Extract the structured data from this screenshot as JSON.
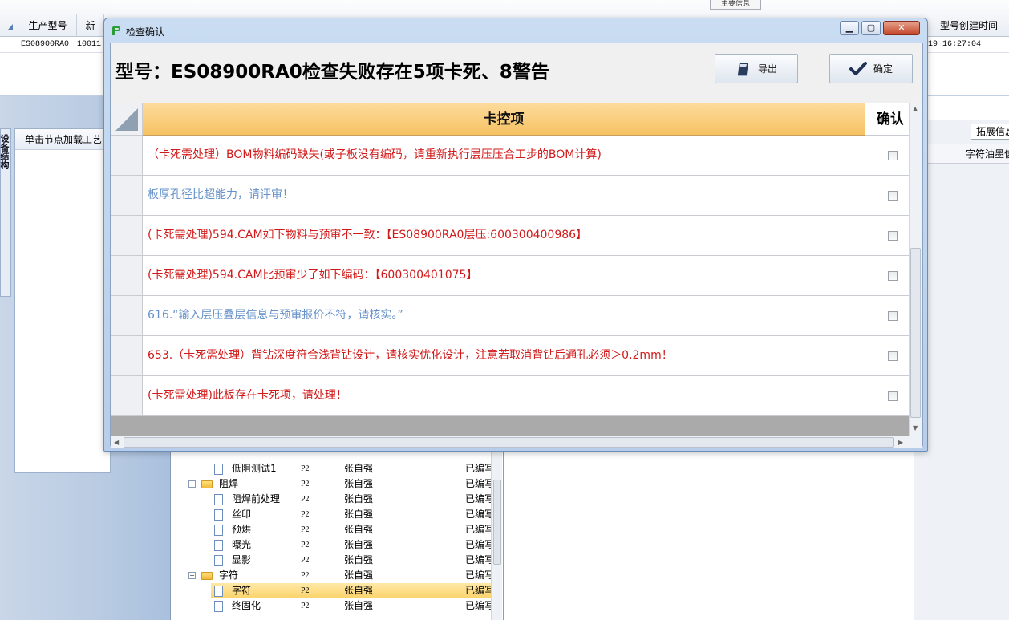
{
  "background": {
    "columns": [
      "生产型号",
      "新",
      "型号创建时间"
    ],
    "info_tab": "主要信息",
    "row": {
      "model": "ES08900RA0",
      "code": "10011",
      "time": "19 16:27:04"
    },
    "left_vtab": "设备结构",
    "left_panel_title": "单击节点加载工艺",
    "right_tab": "拓展信息",
    "right_column": "字符油墨信",
    "tree": [
      {
        "name": "低阻测试1",
        "type": "doc",
        "col1": "P2",
        "col2": "张自强",
        "col3": "已编写"
      },
      {
        "name": "阻焊",
        "type": "folder",
        "col1": "P2",
        "col2": "张自强",
        "col3": "已编写"
      },
      {
        "name": "阻焊前处理",
        "type": "doc",
        "col1": "P2",
        "col2": "张自强",
        "col3": "已编写"
      },
      {
        "name": "丝印",
        "type": "doc",
        "col1": "P2",
        "col2": "张自强",
        "col3": "已编写"
      },
      {
        "name": "预烘",
        "type": "doc",
        "col1": "P2",
        "col2": "张自强",
        "col3": "已编写"
      },
      {
        "name": "曝光",
        "type": "doc",
        "col1": "P2",
        "col2": "张自强",
        "col3": "已编写"
      },
      {
        "name": "显影",
        "type": "doc",
        "col1": "P2",
        "col2": "张自强",
        "col3": "已编写"
      },
      {
        "name": "字符",
        "type": "folder",
        "col1": "P2",
        "col2": "张自强",
        "col3": "已编写"
      },
      {
        "name": "字符",
        "type": "doc",
        "col1": "P2",
        "col2": "张自强",
        "col3": "已编写",
        "selected": true
      },
      {
        "name": "终固化",
        "type": "doc",
        "col1": "P2",
        "col2": "张自强",
        "col3": "已编写"
      }
    ]
  },
  "dialog": {
    "title": "检查确认",
    "message": "型号：ES08900RA0检查失败存在5项卡死、8警告",
    "export_label": "导出",
    "confirm_label": "确定",
    "grid_header_main": "卡控项",
    "grid_header_confirm": "确认",
    "rows": [
      {
        "text": "（卡死需处理）BOM物料编码缺失(或子板没有编码，请重新执行层压压合工步的BOM计算)",
        "level": "error",
        "checked": false
      },
      {
        "text": "板厚孔径比超能力，请评审！",
        "level": "warning",
        "checked": false
      },
      {
        "text": "(卡死需处理)594.CAM如下物料与预审不一致：【ES08900RA0层压:600300400986】",
        "level": "error",
        "checked": false
      },
      {
        "text": "(卡死需处理)594.CAM比预审少了如下编码：【600300401075】",
        "level": "error",
        "checked": false
      },
      {
        "text": "616.“输入层压叠层信息与预审报价不符，请核实。”",
        "level": "warning",
        "checked": false
      },
      {
        "text": "653.（卡死需处理）背钻深度符合浅背钻设计，请核实优化设计，注意若取消背钻后通孔必须＞0.2mm！",
        "level": "error",
        "checked": false
      },
      {
        "text": "(卡死需处理)此板存在卡死项，请处理！",
        "level": "error",
        "checked": false
      }
    ]
  },
  "colors": {
    "error": "#d11a1a",
    "warning": "#6692c9",
    "header": "#f6c262"
  }
}
